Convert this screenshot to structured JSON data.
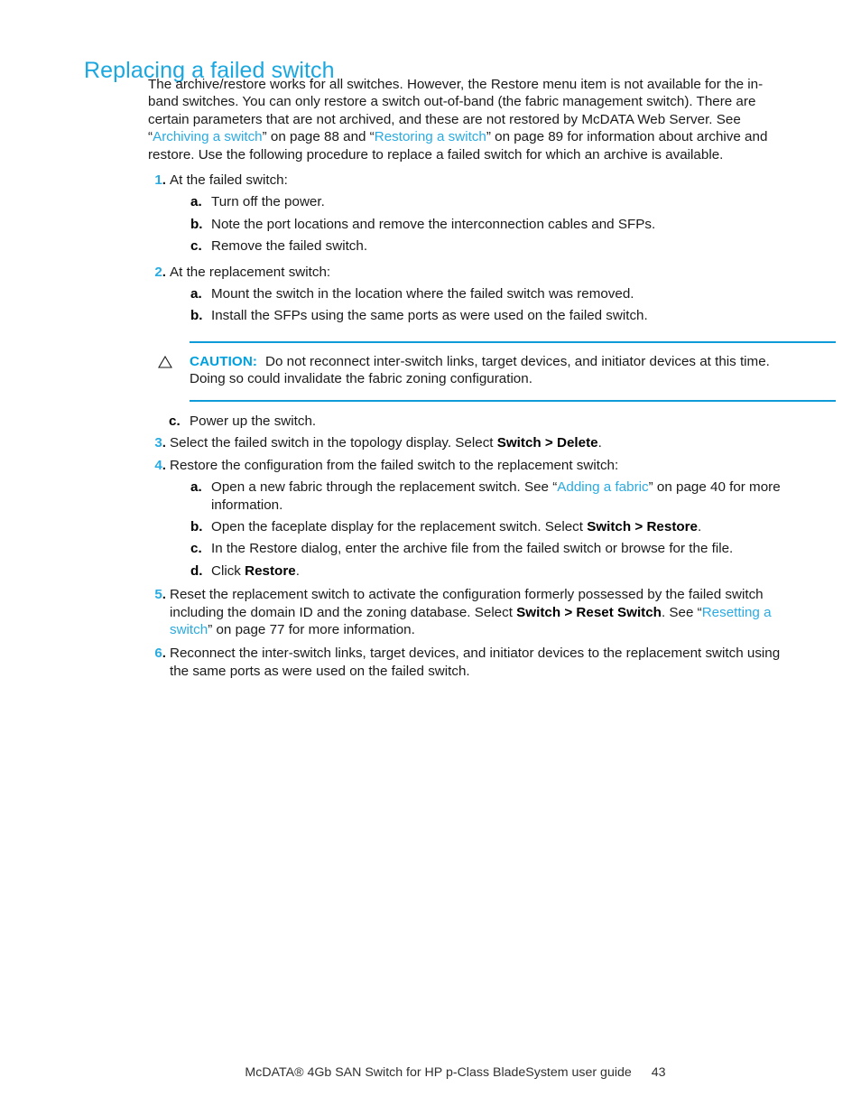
{
  "heading": "Replacing a failed switch",
  "colors": {
    "accent": "#29ABE2",
    "heading": "#1BA7DF",
    "rule": "#0F9BD7",
    "body_text": "#1a1a1a"
  },
  "intro": {
    "part1": "The archive/restore works for all switches. However, the Restore menu item is not available for the in-band switches. You can only restore a switch out-of-band (the fabric management switch). There are certain parameters that are not archived, and these are not restored by McDATA Web Server. See “",
    "link1": "Archiving a switch",
    "part2": "” on page 88 and “",
    "link2": "Restoring a switch",
    "part3": "” on page 89 for information about archive and restore. Use the following procedure to replace a failed switch for which an archive is available."
  },
  "steps": [
    {
      "number": "1",
      "text": "At the failed switch:",
      "substeps": [
        {
          "letter": "a",
          "text": "Turn off the power."
        },
        {
          "letter": "b",
          "text": "Note the port locations and remove the interconnection cables and SFPs."
        },
        {
          "letter": "c",
          "text": "Remove the failed switch."
        }
      ]
    },
    {
      "number": "2",
      "text": "At the replacement switch:",
      "substeps": [
        {
          "letter": "a",
          "text": "Mount the switch in the location where the failed switch was removed."
        },
        {
          "letter": "b",
          "text": "Install the SFPs using the same ports as were used on the failed switch."
        }
      ]
    }
  ],
  "caution": {
    "icon": "warning-triangle-icon",
    "label": "CAUTION:",
    "text": "Do not reconnect inter-switch links, target devices, and initiator devices at this time. Doing so could invalidate the fabric zoning configuration."
  },
  "after_caution_substep": {
    "letter": "c",
    "text": "Power up the switch."
  },
  "steps2": [
    {
      "number": "3",
      "text_part1": "Select the failed switch in the topology display. Select ",
      "bold1": "Switch > Delete",
      "text_part2": "."
    },
    {
      "number": "4",
      "text_part1": "Restore the configuration from the failed switch to the replacement switch:",
      "substeps": [
        {
          "letter": "a",
          "part1": "Open a new fabric through the replacement switch. See “",
          "link": "Adding a fabric",
          "part2": "” on page 40 for more information."
        },
        {
          "letter": "b",
          "part1": "Open the faceplate display for the replacement switch. Select ",
          "bold": "Switch > Restore",
          "part2": "."
        },
        {
          "letter": "c",
          "part1": "In the Restore dialog, enter the archive file from the failed switch or browse for the file.",
          "bold": "",
          "part2": ""
        },
        {
          "letter": "d",
          "part1": "Click ",
          "bold": "Restore",
          "part2": "."
        }
      ]
    },
    {
      "number": "5",
      "part1": "Reset the replacement switch to activate the configuration formerly possessed by the failed switch including the domain ID and the zoning database. Select ",
      "bold": "Switch > Reset Switch",
      "part2": ". See “",
      "link": "Resetting a switch",
      "part3": "” on page 77 for more information."
    },
    {
      "number": "6",
      "part1": "Reconnect the inter-switch links, target devices, and initiator devices to the replacement switch using the same ports as were used on the failed switch."
    }
  ],
  "footer": {
    "title": "McDATA® 4Gb SAN Switch for HP p-Class BladeSystem user guide",
    "page": "43"
  }
}
